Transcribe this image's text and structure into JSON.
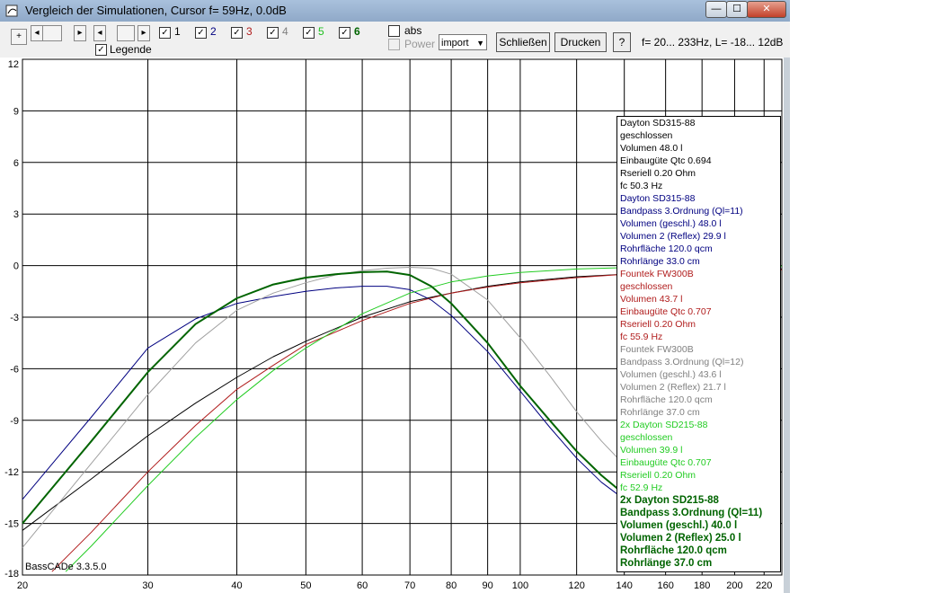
{
  "window": {
    "title": "Vergleich der Simulationen, Cursor f= 59Hz, 0.0dB"
  },
  "titlebar_controls": {
    "minimize": "—",
    "maximize": "☐",
    "close": "✕"
  },
  "toolbar": {
    "plus_label": "+",
    "checkboxes": [
      {
        "label": "1",
        "checked": true,
        "color": "#000000"
      },
      {
        "label": "2",
        "checked": true,
        "color": "#000080"
      },
      {
        "label": "3",
        "checked": true,
        "color": "#b01c1c"
      },
      {
        "label": "4",
        "checked": true,
        "color": "#808080"
      },
      {
        "label": "5",
        "checked": true,
        "color": "#20c020"
      },
      {
        "label": "6",
        "checked": true,
        "color": "#006400"
      }
    ],
    "legende_label": "Legende",
    "abs_label": "abs",
    "power_label": "Power",
    "import_value": "import",
    "close_button": "Schließen",
    "print_button": "Drucken",
    "help_button": "?",
    "range_info": "f=  20... 233Hz, L= -18... 12dB"
  },
  "version_label": "BassCADe 3.3.5.0",
  "legend": [
    {
      "color": "#000000",
      "bold": false,
      "lines": [
        "Dayton SD315-88",
        "geschlossen",
        "Volumen 48.0 l",
        "Einbaugüte Qtc 0.694",
        "Rseriell 0.20 Ohm",
        "fc 50.3 Hz"
      ]
    },
    {
      "color": "#000080",
      "bold": false,
      "lines": [
        "Dayton SD315-88",
        "Bandpass 3.Ordnung (Ql=11)",
        "Volumen (geschl.) 48.0 l",
        "Volumen 2 (Reflex) 29.9 l",
        "Rohrfläche 120.0 qcm",
        "Rohrlänge 33.0 cm"
      ]
    },
    {
      "color": "#b01c1c",
      "bold": false,
      "lines": [
        "Fountek FW300B",
        "geschlossen",
        "Volumen 43.7 l",
        "Einbaugüte Qtc 0.707",
        "Rseriell 0.20 Ohm",
        "fc 55.9 Hz"
      ]
    },
    {
      "color": "#808080",
      "bold": false,
      "lines": [
        "Fountek FW300B",
        "Bandpass 3.Ordnung (Ql=12)",
        "Volumen (geschl.) 43.6 l",
        "Volumen 2 (Reflex) 21.7 l",
        "Rohrfläche 120.0 qcm",
        "Rohrlänge 37.0 cm"
      ]
    },
    {
      "color": "#22cc22",
      "bold": false,
      "lines": [
        "2x Dayton SD215-88",
        "geschlossen",
        "Volumen 39.9 l",
        "Einbaugüte Qtc 0.707",
        "Rseriell 0.20 Ohm",
        "fc 52.9 Hz"
      ]
    },
    {
      "color": "#006400",
      "bold": true,
      "lines": [
        "2x Dayton SD215-88",
        "Bandpass 3.Ordnung (Ql=11)",
        "Volumen (geschl.) 40.0 l",
        "Volumen 2 (Reflex) 25.0 l",
        "Rohrfläche 120.0 qcm",
        "Rohrlänge 37.0 cm"
      ]
    }
  ],
  "chart_data": {
    "type": "line",
    "xscale": "log",
    "xlim": [
      20,
      233
    ],
    "ylim": [
      -18,
      12
    ],
    "grid": true,
    "x_ticks": [
      20,
      30,
      40,
      50,
      60,
      70,
      80,
      90,
      100,
      120,
      140,
      160,
      180,
      200,
      220
    ],
    "y_ticks": [
      12,
      9,
      6,
      3,
      0,
      -3,
      -6,
      -9,
      -12,
      -15,
      -18
    ],
    "series": [
      {
        "color": "#000000",
        "width": 1,
        "x": [
          20,
          25,
          30,
          35,
          40,
          45,
          50,
          60,
          70,
          80,
          90,
          100,
          120,
          140,
          160,
          200,
          233
        ],
        "y": [
          -15.4,
          -12.4,
          -9.9,
          -8.0,
          -6.5,
          -5.3,
          -4.4,
          -3.0,
          -2.1,
          -1.6,
          -1.2,
          -0.95,
          -0.65,
          -0.5,
          -0.4,
          -0.25,
          -0.2
        ]
      },
      {
        "color": "#000080",
        "width": 1,
        "x": [
          20,
          25,
          30,
          35,
          40,
          45,
          50,
          55,
          60,
          65,
          70,
          75,
          80,
          90,
          100,
          110,
          120,
          130,
          140
        ],
        "y": [
          -13.6,
          -8.8,
          -4.8,
          -3.1,
          -2.2,
          -1.8,
          -1.5,
          -1.3,
          -1.2,
          -1.2,
          -1.4,
          -2.0,
          -2.9,
          -5.0,
          -7.3,
          -9.4,
          -11.2,
          -12.6,
          -13.6
        ]
      },
      {
        "color": "#b01c1c",
        "width": 1,
        "x": [
          22,
          25,
          30,
          35,
          40,
          45,
          50,
          60,
          70,
          80,
          90,
          100,
          120,
          140,
          160,
          200,
          233
        ],
        "y": [
          -17.8,
          -15.5,
          -12.0,
          -9.3,
          -7.2,
          -5.8,
          -4.6,
          -3.2,
          -2.2,
          -1.6,
          -1.25,
          -1.0,
          -0.7,
          -0.5,
          -0.4,
          -0.3,
          -0.25
        ]
      },
      {
        "color": "#a0a0a0",
        "width": 1,
        "x": [
          20,
          25,
          30,
          35,
          40,
          45,
          50,
          55,
          60,
          65,
          70,
          75,
          80,
          90,
          100,
          110,
          120,
          130,
          140
        ],
        "y": [
          -16.4,
          -11.5,
          -7.5,
          -4.5,
          -2.6,
          -1.6,
          -1.0,
          -0.55,
          -0.3,
          -0.15,
          -0.1,
          -0.15,
          -0.5,
          -2.0,
          -4.2,
          -6.4,
          -8.5,
          -10.2,
          -11.6
        ]
      },
      {
        "color": "#22cc22",
        "width": 1,
        "x": [
          23,
          25,
          30,
          35,
          40,
          45,
          50,
          60,
          70,
          80,
          90,
          100,
          120,
          140,
          160,
          200,
          233
        ],
        "y": [
          -17.8,
          -16.3,
          -12.8,
          -10.0,
          -7.8,
          -6.1,
          -4.8,
          -2.8,
          -1.6,
          -0.95,
          -0.6,
          -0.4,
          -0.2,
          -0.12,
          -0.08,
          -0.05,
          -0.03
        ]
      },
      {
        "color": "#006400",
        "width": 2,
        "x": [
          20,
          25,
          30,
          35,
          40,
          45,
          50,
          55,
          60,
          65,
          70,
          75,
          80,
          90,
          100,
          110,
          120,
          130,
          140
        ],
        "y": [
          -15.0,
          -10.2,
          -6.2,
          -3.4,
          -1.9,
          -1.1,
          -0.7,
          -0.5,
          -0.38,
          -0.35,
          -0.55,
          -1.2,
          -2.2,
          -4.5,
          -7.0,
          -9.0,
          -10.8,
          -12.2,
          -13.3
        ]
      }
    ]
  }
}
